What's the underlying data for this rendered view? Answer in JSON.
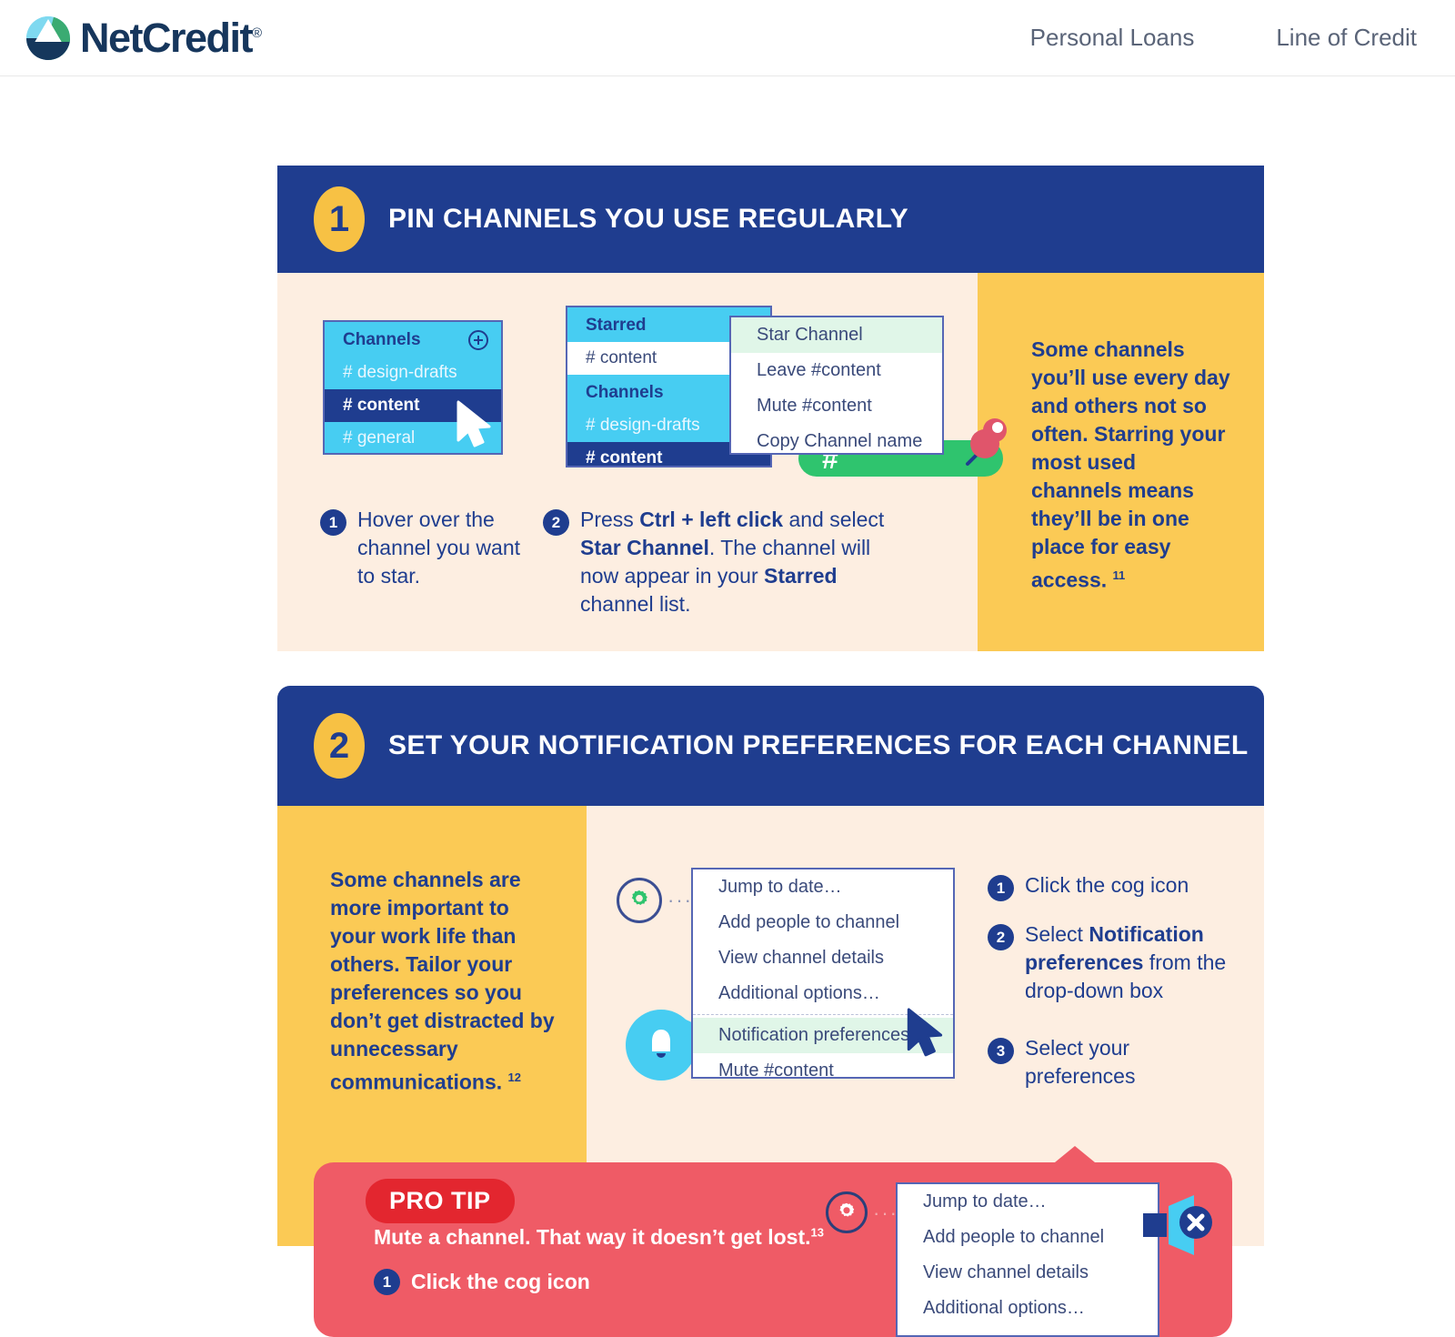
{
  "header": {
    "brand": "NetCredit",
    "brand_reg": "®",
    "nav": [
      {
        "label": "Personal Loans"
      },
      {
        "label": "Line of Credit"
      }
    ]
  },
  "colors": {
    "navy": "#1f3d8f",
    "yellow": "#fbca55",
    "cream": "#fdeee1",
    "red": "#ef5b66",
    "red_dark": "#e3262f",
    "cyan": "#47cdf2",
    "green": "#2fc46e"
  },
  "sections": [
    {
      "number": "1",
      "title": "PIN CHANNELS YOU USE REGULARLY",
      "channel_panel_1": {
        "header": "Channels",
        "add_icon": "plus-circle-icon",
        "rows": [
          {
            "label": "# design-drafts",
            "state": "normal"
          },
          {
            "label": "# content",
            "state": "selected"
          },
          {
            "label": "# general",
            "state": "normal"
          }
        ]
      },
      "channel_panel_2": {
        "starred_header": "Starred",
        "starred_rows": [
          {
            "label": "# content",
            "state": "white"
          }
        ],
        "channels_header": "Channels",
        "channel_rows": [
          {
            "label": "# design-drafts",
            "state": "normal"
          },
          {
            "label": "# content",
            "state": "selected"
          }
        ]
      },
      "context_menu": {
        "items": [
          {
            "label": "Star Channel",
            "highlighted": true
          },
          {
            "label": "Leave #content",
            "highlighted": false
          },
          {
            "label": "Mute #content",
            "highlighted": false
          },
          {
            "label": "Copy Channel name",
            "highlighted": false
          }
        ]
      },
      "pill_label": "#",
      "steps": [
        {
          "num": "1",
          "html": "Hover over the channel you want to star."
        },
        {
          "num": "2",
          "html": "Press <b>Ctrl + left click</b> and select <b>Star Channel</b>. The channel will now appear in your <b>Starred</b> channel list."
        }
      ],
      "side_note": "Some channels you’ll use every day and others not so often. Starring your most used channels means they’ll be in one place for easy access.",
      "side_note_ref": "11"
    },
    {
      "number": "2",
      "title": "SET YOUR NOTIFICATION PREFERENCES FOR EACH CHANNEL",
      "side_note": "Some channels are more important to your work life than others. Tailor your preferences so you don’t get distracted by unnecessary communications.",
      "side_note_ref": "12",
      "cog_icon": "gear-icon",
      "dots": "···",
      "bell_icon": "bell-icon",
      "menu": {
        "items": [
          {
            "label": "Jump to date…",
            "highlighted": false
          },
          {
            "label": "Add people to channel",
            "highlighted": false
          },
          {
            "label": "View channel details",
            "highlighted": false
          },
          {
            "label": "Additional options…",
            "highlighted": false
          },
          {
            "label": "Notification preferences…",
            "highlighted": true,
            "separator_before": true
          },
          {
            "label": "Mute #content",
            "highlighted": false
          }
        ]
      },
      "steps": [
        {
          "num": "1",
          "html": "Click the cog icon"
        },
        {
          "num": "2",
          "html": "Select <b>Notification preferences</b> from the drop-down box"
        },
        {
          "num": "3",
          "html": "Select your preferences"
        }
      ]
    }
  ],
  "protip": {
    "badge": "PRO TIP",
    "line": "Mute a channel. That way it doesn’t get lost.",
    "line_ref": "13",
    "cog_icon": "gear-icon",
    "dots": "···",
    "mute_icon": "speaker-mute-icon",
    "steps": [
      {
        "num": "1",
        "html": "Click the cog icon"
      }
    ],
    "menu": {
      "items": [
        {
          "label": "Jump to date…"
        },
        {
          "label": "Add people to channel"
        },
        {
          "label": "View channel details"
        },
        {
          "label": "Additional options…"
        }
      ]
    }
  }
}
